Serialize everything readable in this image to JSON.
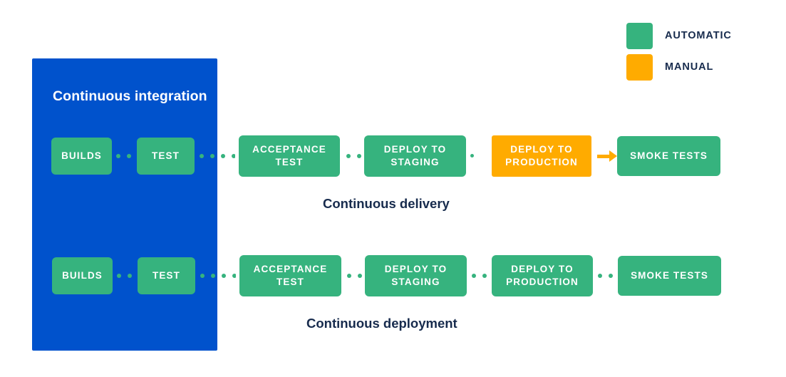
{
  "legend": {
    "items": [
      {
        "label": "AUTOMATIC",
        "color": "#36B37E",
        "swatch_name": "automatic-swatch"
      },
      {
        "label": "MANUAL",
        "color": "#FFAB00",
        "swatch_name": "manual-swatch"
      }
    ]
  },
  "ci_panel": {
    "title": "Continuous integration",
    "color": "#0052CC"
  },
  "pipelines": [
    {
      "id": "continuous-delivery",
      "caption": "Continuous delivery",
      "stages": [
        {
          "label": "BUILDS",
          "type": "automatic",
          "color": "#36B37E"
        },
        {
          "label": "TEST",
          "type": "automatic",
          "color": "#36B37E"
        },
        {
          "label": "ACCEPTANCE TEST",
          "type": "automatic",
          "color": "#36B37E"
        },
        {
          "label": "DEPLOY TO STAGING",
          "type": "automatic",
          "color": "#36B37E"
        },
        {
          "label": "DEPLOY TO PRODUCTION",
          "type": "manual",
          "color": "#FFAB00"
        },
        {
          "label": "SMOKE TESTS",
          "type": "automatic",
          "color": "#36B37E"
        }
      ],
      "connectors": [
        "dotted",
        "dotted",
        "dotted",
        "dotted",
        "arrow"
      ]
    },
    {
      "id": "continuous-deployment",
      "caption": "Continuous deployment",
      "stages": [
        {
          "label": "BUILDS",
          "type": "automatic",
          "color": "#36B37E"
        },
        {
          "label": "TEST",
          "type": "automatic",
          "color": "#36B37E"
        },
        {
          "label": "ACCEPTANCE TEST",
          "type": "automatic",
          "color": "#36B37E"
        },
        {
          "label": "DEPLOY TO STAGING",
          "type": "automatic",
          "color": "#36B37E"
        },
        {
          "label": "DEPLOY TO PRODUCTION",
          "type": "automatic",
          "color": "#36B37E"
        },
        {
          "label": "SMOKE TESTS",
          "type": "automatic",
          "color": "#36B37E"
        }
      ],
      "connectors": [
        "dotted",
        "dotted",
        "dotted",
        "dotted",
        "dotted"
      ]
    }
  ],
  "text_color": "#172B4D"
}
